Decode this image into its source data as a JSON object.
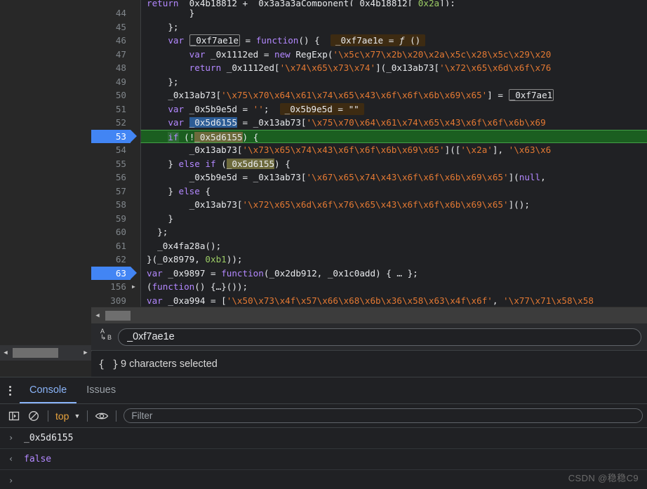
{
  "editor": {
    "name": "sources-code-editor",
    "top_partial_line": "return _0x4b18812 + _0x3a3a3aComponent(_0x4b18812[_0x2a]);",
    "lines": [
      {
        "num": "44",
        "breakpoint": false,
        "fold": false,
        "exec": false,
        "text": "        }"
      },
      {
        "num": "45",
        "breakpoint": false,
        "fold": false,
        "exec": false,
        "text": "    };"
      },
      {
        "num": "46",
        "breakpoint": false,
        "fold": false,
        "exec": false,
        "text": "    var _0xf7ae1e = function() {   _0xf7ae1e = ƒ ()"
      },
      {
        "num": "47",
        "breakpoint": false,
        "fold": false,
        "exec": false,
        "text": "        var _0x1112ed = new RegExp('\\x5c\\x77\\x2b\\x20\\x2a\\x5c\\x28\\x5c\\x29\\x20"
      },
      {
        "num": "48",
        "breakpoint": false,
        "fold": false,
        "exec": false,
        "text": "        return _0x1112ed['\\x74\\x65\\x73\\x74'](_0x13ab73['\\x72\\x65\\x6d\\x6f\\x76"
      },
      {
        "num": "49",
        "breakpoint": false,
        "fold": false,
        "exec": false,
        "text": "    };"
      },
      {
        "num": "50",
        "breakpoint": false,
        "fold": false,
        "exec": false,
        "text": "    _0x13ab73['\\x75\\x70\\x64\\x61\\x74\\x65\\x43\\x6f\\x6f\\x6b\\x69\\x65'] = _0xf7ae1"
      },
      {
        "num": "51",
        "breakpoint": false,
        "fold": false,
        "exec": false,
        "text": "    var _0x5b9e5d = '';   _0x5b9e5d = \"\""
      },
      {
        "num": "52",
        "breakpoint": false,
        "fold": false,
        "exec": false,
        "text": "    var _0x5d6155 = _0x13ab73['\\x75\\x70\\x64\\x61\\x74\\x65\\x43\\x6f\\x6f\\x6b\\x69"
      },
      {
        "num": "53",
        "breakpoint": true,
        "fold": false,
        "exec": true,
        "text": "    if (!_0x5d6155) {"
      },
      {
        "num": "54",
        "breakpoint": false,
        "fold": false,
        "exec": false,
        "text": "        _0x13ab73['\\x73\\x65\\x74\\x43\\x6f\\x6f\\x6b\\x69\\x65'](['\\x2a'], '\\x63\\x6"
      },
      {
        "num": "55",
        "breakpoint": false,
        "fold": false,
        "exec": false,
        "text": "    } else if (_0x5d6155) {"
      },
      {
        "num": "56",
        "breakpoint": false,
        "fold": false,
        "exec": false,
        "text": "        _0x5b9e5d = _0x13ab73['\\x67\\x65\\x74\\x43\\x6f\\x6f\\x6b\\x69\\x65'](null,"
      },
      {
        "num": "57",
        "breakpoint": false,
        "fold": false,
        "exec": false,
        "text": "    } else {"
      },
      {
        "num": "58",
        "breakpoint": false,
        "fold": false,
        "exec": false,
        "text": "        _0x13ab73['\\x72\\x65\\x6d\\x6f\\x76\\x65\\x43\\x6f\\x6f\\x6b\\x69\\x65']();"
      },
      {
        "num": "59",
        "breakpoint": false,
        "fold": false,
        "exec": false,
        "text": "    }"
      },
      {
        "num": "60",
        "breakpoint": false,
        "fold": false,
        "exec": false,
        "text": "  };"
      },
      {
        "num": "61",
        "breakpoint": false,
        "fold": false,
        "exec": false,
        "text": "  _0x4fa28a();"
      },
      {
        "num": "62",
        "breakpoint": false,
        "fold": false,
        "exec": false,
        "text": "}(_0x8979, 0xb1));"
      },
      {
        "num": "63",
        "breakpoint": true,
        "fold": true,
        "exec": false,
        "text": "var _0x9897 = function(_0x2db912, _0x1c0add) { … };"
      },
      {
        "num": "156",
        "breakpoint": false,
        "fold": true,
        "exec": false,
        "text": "(function() {…}());"
      },
      {
        "num": "309",
        "breakpoint": false,
        "fold": false,
        "exec": false,
        "text": "var _0xa994 = ['\\x50\\x73\\x4f\\x57\\x66\\x68\\x6b\\x36\\x58\\x63\\x4f\\x6f', '\\x77\\x71\\x58\\x58"
      }
    ]
  },
  "rename": {
    "icon_a": "A",
    "icon_arrow": "↳",
    "icon_b": "B",
    "value": "_0xf7ae1e",
    "placeholder": ""
  },
  "status": {
    "icon": "{ }",
    "text": "9 characters selected"
  },
  "drawer": {
    "tabs": [
      {
        "label": "Console",
        "active": true
      },
      {
        "label": "Issues",
        "active": false
      }
    ],
    "toolbar": {
      "sidebar_toggle": "show-console-sidebar-icon",
      "clear": "clear-console-icon",
      "context": "top",
      "context_caret": "▼",
      "eye": "live-expression-icon",
      "filter_placeholder": "Filter"
    },
    "messages": [
      {
        "kind": "input",
        "arrow": "›",
        "text": "_0x5d6155"
      },
      {
        "kind": "output",
        "arrow": "‹",
        "text": "false"
      }
    ],
    "prompt_arrow": "›"
  },
  "watermark": "CSDN @稳稳C9",
  "colors": {
    "background": "#202124",
    "gutter": "#282828",
    "breakpoint": "#4285f4",
    "exec_line": "#1b5e20",
    "exec_border": "#43a047",
    "keyword": "#b388ff",
    "string": "#e37933",
    "number": "#9ccc65",
    "accent_tab": "#8ab4f8",
    "context_orange": "#e8a33d",
    "selection_blue": "#2c5c95",
    "selection_olive": "#6d6a3c",
    "inline_hint": "#3d2b12"
  }
}
